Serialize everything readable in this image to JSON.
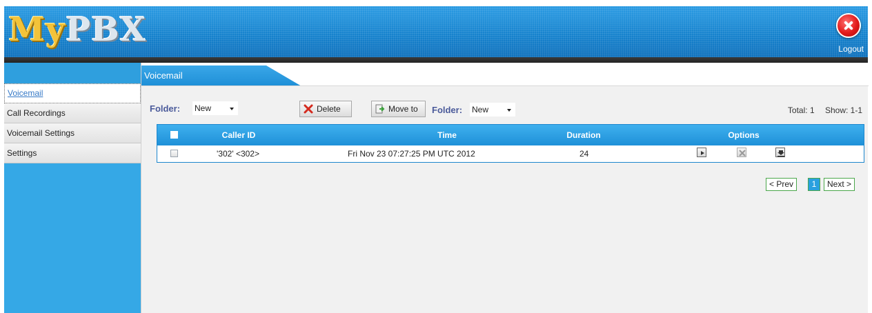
{
  "header": {
    "logo_part1": "My",
    "logo_part2": "PBX",
    "logout_label": "Logout"
  },
  "sidebar": {
    "items": [
      {
        "label": "Voicemail",
        "active": true
      },
      {
        "label": "Call Recordings"
      },
      {
        "label": "Voicemail Settings"
      },
      {
        "label": "Settings"
      }
    ]
  },
  "tab": {
    "label": "Voicemail"
  },
  "toolbar": {
    "folder_label": "Folder:",
    "folder_value": "New",
    "delete_label": "Delete",
    "moveto_label": "Move to",
    "target_folder_label": "Folder:",
    "target_folder_value": "New",
    "total": "Total: 1",
    "show": "Show: 1-1"
  },
  "table": {
    "columns": [
      "Caller ID",
      "Time",
      "Duration",
      "Options"
    ],
    "rows": [
      {
        "caller_id": "'302' <302>",
        "time": "Fri Nov 23 07:27:25 PM UTC 2012",
        "duration": "24",
        "options": [
          "play-icon",
          "delete-icon",
          "download-icon"
        ]
      }
    ]
  },
  "pagination": {
    "prev": "< Prev",
    "current": "1",
    "next": "Next >"
  }
}
